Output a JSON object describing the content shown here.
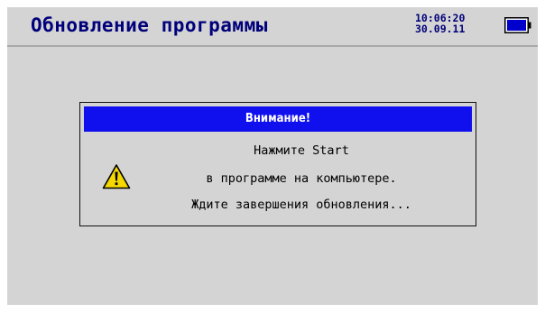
{
  "header": {
    "title": "Обновление программы",
    "time": "10:06:20",
    "date": "30.09.11",
    "battery_icon": "battery-full-icon"
  },
  "dialog": {
    "title": "Внимание!",
    "icon": "warning-icon",
    "lines": [
      "Нажмите Start",
      "в программе на компьютере.",
      "Ждите завершения обновления..."
    ]
  },
  "colors": {
    "background": "#d4d4d4",
    "title_text": "#00007a",
    "dialog_titlebar": "#1010ee",
    "warning_yellow": "#f5d800"
  }
}
